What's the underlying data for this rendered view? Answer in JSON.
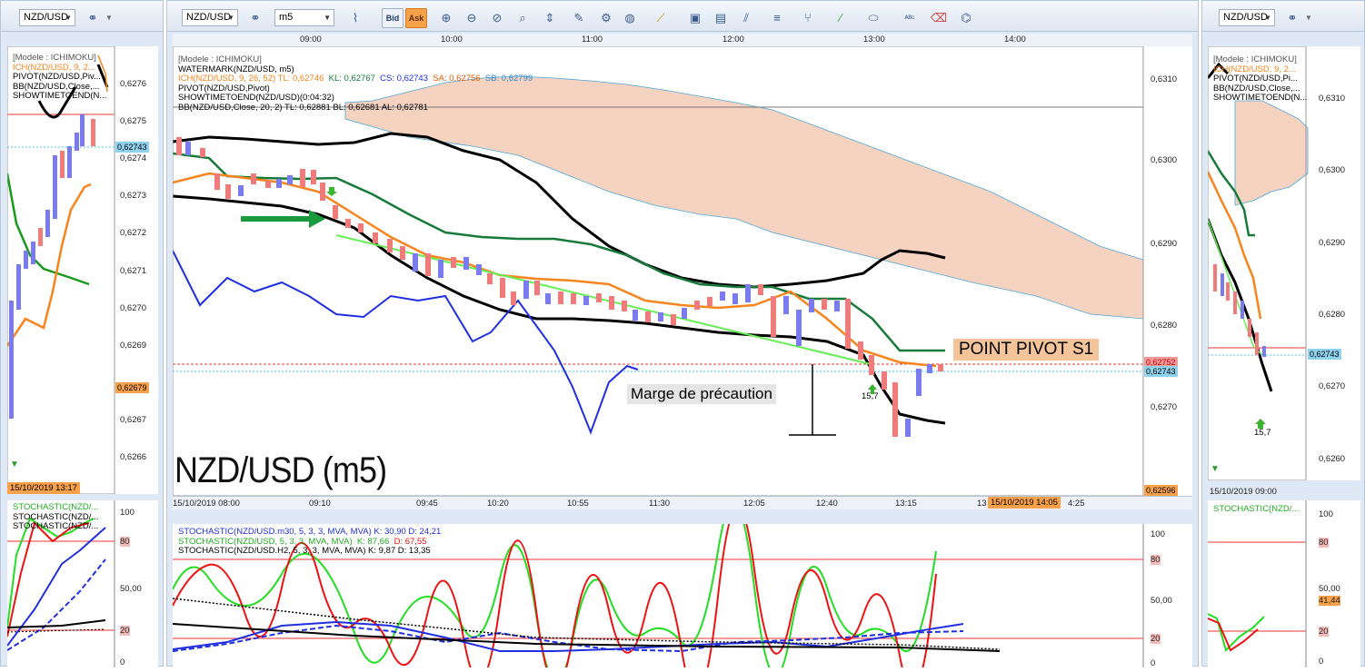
{
  "left_window": {
    "symbol": "NZD/USD",
    "legend": [
      "[Modele : ICHIMOKU]",
      "ICH(NZD/USD, 9, 2...",
      "PIVOT(NZD/USD,Piv...",
      "BB(NZD/USD,Close,...",
      "SHOWTIMETOEND(N..."
    ],
    "price_axis": [
      "0,6276",
      "0,6275",
      "0,6274",
      "0,6273",
      "0,6272",
      "0,6271",
      "0,6270",
      "0,6269",
      "0,6267",
      "0,6266"
    ],
    "price_tag_blue": "0,62743",
    "price_tag_orange": "0,62679",
    "date_tag": "15/10/2019 13:17",
    "stoch_legend": [
      "STOCHASTIC(NZD/...",
      "STOCHASTIC(NZD/...",
      "STOCHASTIC(NZD/..."
    ],
    "stoch_axis": [
      "100",
      "80",
      "50,00",
      "20",
      "0"
    ]
  },
  "main_window": {
    "symbol": "NZD/USD",
    "timeframe": "m5",
    "toolbar": {
      "bid_label": "Bid",
      "ask_label": "Ask"
    },
    "top_times": [
      "09:00",
      "10:00",
      "11:00",
      "12:00",
      "13:00",
      "14:00"
    ],
    "legend": {
      "l1": "[Modele : ICHIMOKU]",
      "l2": "WATERMARK(NZD/USD, m5)",
      "ich_name": "ICH(NZD/USD, 9, 26, 52)",
      "tl": "TL: 0,62746",
      "kl": "KL: 0,62767",
      "cs": "CS: 0,62743",
      "sa": "SA: 0,62756",
      "sb": "SB: 0,62799",
      "l4": "PIVOT(NZD/USD,Pivot)",
      "l5": "SHOWTIMETOEND(NZD/USD)(0:04:32)",
      "l6": "BB(NZD/USD,Close, 20, 2)  TL: 0,62881  BL: 0,62681  AL: 0,62781"
    },
    "price_axis": [
      "0,6310",
      "0,6300",
      "0,6290",
      "0,6280",
      "0,6270"
    ],
    "price_tag_red": "0,62752",
    "price_tag_blue": "0,62743",
    "price_tag_orange": "0,62596",
    "watermark": "NZD/USD (m5)",
    "annotation_pivot": "POINT PIVOT S1",
    "annotation_marge": "Marge de précaution",
    "arrow_value": "15,7",
    "bottom_times": [
      "15/10/2019 08:00",
      "09:10",
      "09:45",
      "10:20",
      "10:55",
      "11:30",
      "12:05",
      "12:40",
      "13:15",
      "13",
      "4:25"
    ],
    "bottom_date_tag": "15/10/2019 14:05",
    "stoch_legend": {
      "s1": "STOCHASTIC(NZD/USD.m30, 5, 3, 3, MVA, MVA)  K: 30,90  D: 24,21",
      "s2_name": "STOCHASTIC(NZD/USD, 5, 3, 3, MVA, MVA)",
      "s2_k": "K: 87,66",
      "s2_d": "D: 67,55",
      "s3": "STOCHASTIC(NZD/USD.H2, 5, 3, 3, MVA, MVA)  K: 9,87  D: 13,35"
    },
    "stoch_axis": [
      "100",
      "80",
      "50,00",
      "20",
      "0"
    ]
  },
  "right_window": {
    "symbol": "NZD/USD",
    "legend": [
      "[Modele : ICHIMOKU]",
      "ICH(NZD/USD, 9, 2...",
      "PIVOT(NZD/USD,Pi...",
      "BB(NZD/USD,Close,...",
      "SHOWTIMETOEND(N..."
    ],
    "price_axis": [
      "0,6310",
      "0,6300",
      "0,6290",
      "0,6280",
      "0,6270",
      "0,6260"
    ],
    "price_tag_blue": "0,62743",
    "arrow_value": "15,7",
    "date_tag": "15/10/2019 09:00",
    "stoch_legend": "STOCHASTIC(NZD/...",
    "stoch_axis": [
      "100",
      "80",
      "50,00",
      "41,44",
      "20",
      "0"
    ]
  },
  "colors": {
    "cloud": "#f6d2c0",
    "tenkan": "#f7841c",
    "kijun": "#177a3a",
    "bollinger": "#000000",
    "blue_line": "#1f2fe0",
    "trend": "#66ee55",
    "bull_candle": "#7b7bf0",
    "bear_candle": "#f07b7b",
    "stoch_k": "#22dd22",
    "stoch_d": "#ee1111"
  }
}
